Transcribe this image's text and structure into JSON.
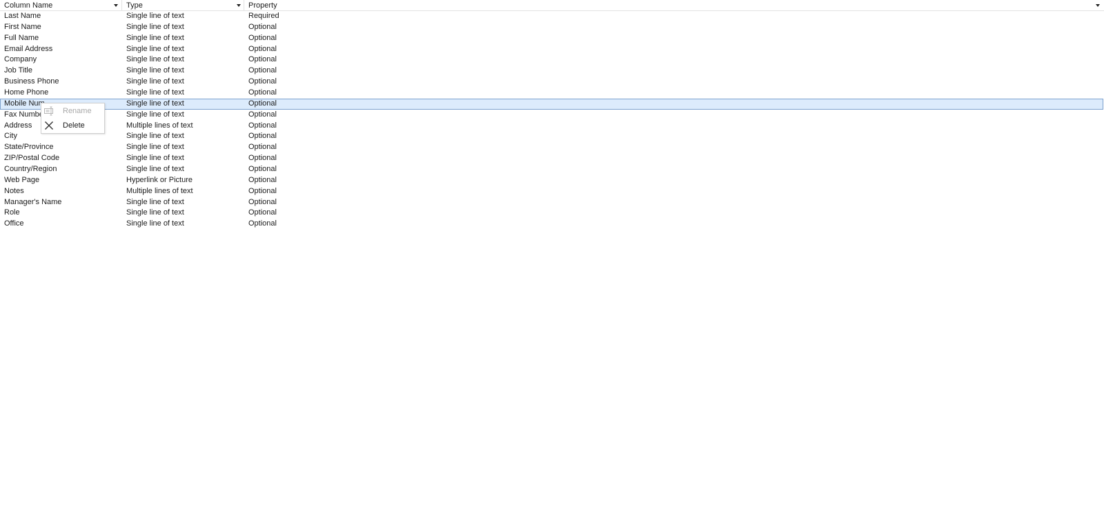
{
  "headers": {
    "column_name": "Column Name",
    "type": "Type",
    "property": "Property"
  },
  "rows": [
    {
      "name": "Last Name",
      "type": "Single line of text",
      "property": "Required"
    },
    {
      "name": "First Name",
      "type": "Single line of text",
      "property": "Optional"
    },
    {
      "name": "Full Name",
      "type": "Single line of text",
      "property": "Optional"
    },
    {
      "name": "Email Address",
      "type": "Single line of text",
      "property": "Optional"
    },
    {
      "name": "Company",
      "type": "Single line of text",
      "property": "Optional"
    },
    {
      "name": "Job Title",
      "type": "Single line of text",
      "property": "Optional"
    },
    {
      "name": "Business Phone",
      "type": "Single line of text",
      "property": "Optional"
    },
    {
      "name": "Home Phone",
      "type": "Single line of text",
      "property": "Optional"
    },
    {
      "name": "Mobile Num",
      "type": "Single line of text",
      "property": "Optional",
      "selected": true
    },
    {
      "name": "Fax Numbe",
      "type": "Single line of text",
      "property": "Optional"
    },
    {
      "name": "Address",
      "type": "Multiple lines of text",
      "property": "Optional"
    },
    {
      "name": "City",
      "type": "Single line of text",
      "property": "Optional"
    },
    {
      "name": "State/Province",
      "type": "Single line of text",
      "property": "Optional"
    },
    {
      "name": "ZIP/Postal Code",
      "type": "Single line of text",
      "property": "Optional"
    },
    {
      "name": "Country/Region",
      "type": "Single line of text",
      "property": "Optional"
    },
    {
      "name": "Web Page",
      "type": "Hyperlink or Picture",
      "property": "Optional"
    },
    {
      "name": "Notes",
      "type": "Multiple lines of text",
      "property": "Optional"
    },
    {
      "name": "Manager's Name",
      "type": "Single line of text",
      "property": "Optional"
    },
    {
      "name": "Role",
      "type": "Single line of text",
      "property": "Optional"
    },
    {
      "name": "Office",
      "type": "Single line of text",
      "property": "Optional"
    }
  ],
  "context_menu": {
    "items": [
      {
        "label": "Rename",
        "icon": "rename-icon",
        "enabled": false
      },
      {
        "label": "Delete",
        "icon": "delete-icon",
        "enabled": true
      }
    ]
  },
  "colors": {
    "selection_bg": "#dcebfc",
    "selection_border": "#7da2ce",
    "disabled_text": "#a8a8a8"
  }
}
